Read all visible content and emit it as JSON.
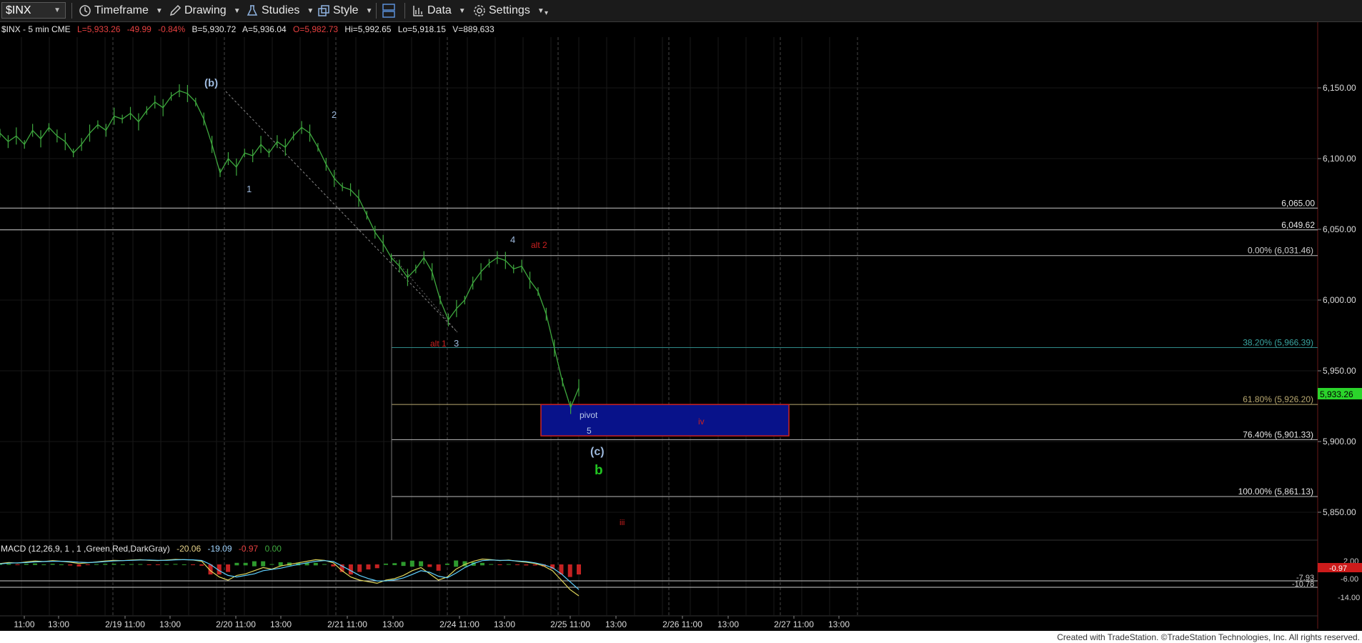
{
  "toolbar": {
    "symbol": "$INX",
    "items": [
      {
        "name": "timeframe",
        "label": "Timeframe",
        "icon": "clock-icon"
      },
      {
        "name": "drawing",
        "label": "Drawing",
        "icon": "pencil-icon"
      },
      {
        "name": "studies",
        "label": "Studies",
        "icon": "flask-icon"
      },
      {
        "name": "style",
        "label": "Style",
        "icon": "style-icon"
      },
      {
        "name": "layout",
        "label": "",
        "icon": "layout-icon"
      },
      {
        "name": "data",
        "label": "Data",
        "icon": "bar-chart-icon"
      },
      {
        "name": "settings",
        "label": "Settings",
        "icon": "gear-icon"
      }
    ]
  },
  "header": {
    "symbol_label": "$INX - 5 min  CME",
    "last": "L=5,933.26",
    "change": "-49.99",
    "change_pct": "-0.84%",
    "bid": "B=5,930.72",
    "ask": "A=5,936.04",
    "open": "O=5,982.73",
    "high": "Hi=5,992.65",
    "low": "Lo=5,918.15",
    "volume": "V=889,633"
  },
  "colors": {
    "background": "#000000",
    "price_line": "#3ea83e",
    "up_red": "#e03030",
    "label_blue": "#9db9dd",
    "label_red": "#cc2020",
    "label_green": "#22c622",
    "fib_color": "#b8a870",
    "box_fill": "#08128a",
    "box_border": "#cc2222",
    "last_price_bg": "#2bd42b"
  },
  "chart_data": {
    "type": "line",
    "title": "",
    "price_axis": {
      "min": 5815,
      "max": 6185,
      "ticks": [
        "6,150.00",
        "6,100.00",
        "6,050.00",
        "6,000.00",
        "5,950.00",
        "5,900.00",
        "5,850.00"
      ]
    },
    "time_ticks": [
      "11:00",
      "13:00",
      "2/19 11:00",
      "13:00",
      "2/20 11:00",
      "13:00",
      "2/21 11:00",
      "13:00",
      "2/24 11:00",
      "13:00",
      "2/25 11:00",
      "13:00",
      "2/26 11:00",
      "13:00",
      "2/27 11:00",
      "13:00"
    ],
    "series": [
      {
        "values": [
          6118,
          6112,
          6116,
          6110,
          6120,
          6114,
          6122,
          6116,
          6112,
          6104,
          6110,
          6118,
          6124,
          6120,
          6130,
          6128,
          6132,
          6126,
          6134,
          6140,
          6136,
          6144,
          6148,
          6146,
          6140,
          6128,
          6110,
          6090,
          6100,
          6094,
          6104,
          6102,
          6110,
          6104,
          6112,
          6108,
          6116,
          6122,
          6118,
          6108,
          6096,
          6086,
          6080,
          6078,
          6072,
          6060,
          6048,
          6040,
          6030,
          6024,
          6016,
          6022,
          6030,
          6020,
          6000,
          5986,
          5994,
          6000,
          6012,
          6020,
          6026,
          6030,
          6028,
          6022,
          6024,
          6014,
          6006,
          5990,
          5966,
          5942,
          5924,
          5938
        ]
      }
    ],
    "horizontal_levels": [
      {
        "label": "6,065.00",
        "value": 6065.0
      },
      {
        "label": "6,049.62",
        "value": 6049.62
      }
    ],
    "fib_levels": [
      {
        "label": "0.00% (6,031.46)",
        "value": 6031.46
      },
      {
        "label": "38.20% (5,966.39)",
        "value": 5966.39
      },
      {
        "label": "61.80% (5,926.20)",
        "value": 5926.2
      },
      {
        "label": "76.40% (5,901.33)",
        "value": 5901.33
      },
      {
        "label": "100.00% (5,861.13)",
        "value": 5861.13
      }
    ],
    "last_price": {
      "label": "5,933.26",
      "value": 5933.26
    },
    "wave_labels": [
      {
        "text": "(b)",
        "color": "blue",
        "bold": true
      },
      {
        "text": "1",
        "color": "blue"
      },
      {
        "text": "2",
        "color": "blue"
      },
      {
        "text": "3",
        "color": "blue"
      },
      {
        "text": "alt 1",
        "color": "red"
      },
      {
        "text": "4",
        "color": "blue"
      },
      {
        "text": "alt 2",
        "color": "red"
      },
      {
        "text": "pivot",
        "color": "blue"
      },
      {
        "text": "5",
        "color": "blue"
      },
      {
        "text": "iv",
        "color": "red"
      },
      {
        "text": "(c)",
        "color": "blue",
        "bold": true
      },
      {
        "text": "b",
        "color": "green",
        "bold": true
      },
      {
        "text": "iii",
        "color": "red"
      }
    ],
    "support_box": {
      "high": 5926.2,
      "low": 5904.0
    }
  },
  "macd": {
    "label": "MACD (12,26,9, 1 , 1 ,Green,Red,DarkGray)",
    "v1": "-20.06",
    "v2": "-19.09",
    "v3": "-0.97",
    "v4": "0.00",
    "axis_ticks": [
      "2.00",
      "-6.00",
      "-14.00"
    ],
    "markers": [
      "-0.97",
      "-7.93",
      "-10.78"
    ],
    "macd_line": [
      0.5,
      1.2,
      0.8,
      1.6,
      2.2,
      1.8,
      2.4,
      2.0,
      1.4,
      0.6,
      1.0,
      1.6,
      2.2,
      2.6,
      2.4,
      2.8,
      3.0,
      2.6,
      2.4,
      2.8,
      3.2,
      3.0,
      2.8,
      2.0,
      -4,
      -8,
      -10,
      -7,
      -6,
      -4,
      -2,
      -3,
      -1,
      0,
      1,
      2,
      3,
      2.6,
      1.0,
      -4,
      -8,
      -10,
      -11,
      -12,
      -10,
      -9,
      -7,
      -4,
      -2,
      -6,
      -10,
      -8,
      -3,
      0,
      2,
      3.4,
      3.0,
      2.4,
      2.8,
      2.0,
      1.4,
      0.6,
      -1,
      -4,
      -10,
      -16,
      -20
    ],
    "signal_line": [
      0.3,
      0.8,
      1.0,
      1.2,
      1.6,
      1.8,
      2.0,
      2.0,
      1.8,
      1.4,
      1.2,
      1.4,
      1.8,
      2.2,
      2.4,
      2.6,
      2.8,
      2.8,
      2.6,
      2.6,
      2.9,
      3.0,
      2.9,
      2.5,
      0,
      -4,
      -7,
      -8,
      -7,
      -6,
      -4,
      -3.2,
      -2.4,
      -1.2,
      0,
      1,
      2,
      2.4,
      1.8,
      -1,
      -4,
      -7,
      -9,
      -10.5,
      -10.5,
      -9.8,
      -8.6,
      -6.4,
      -4,
      -5,
      -7.5,
      -8.5,
      -5.5,
      -2,
      0.6,
      2.4,
      2.8,
      2.6,
      2.6,
      2.2,
      1.8,
      1.0,
      -0.2,
      -2.2,
      -6,
      -11,
      -16
    ]
  },
  "footer": {
    "credit": "Created with TradeStation. ©TradeStation Technologies, Inc. All rights reserved."
  }
}
